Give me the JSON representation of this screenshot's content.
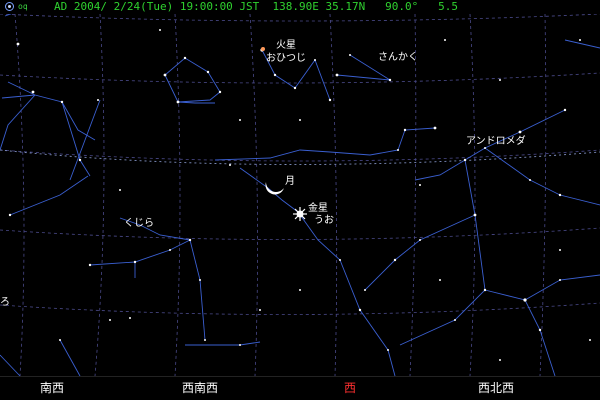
{
  "status": {
    "logo_text": "oq",
    "text": "AD 2004/ 2/24(Tue) 19:00:00 JST  138.90E 35.17N   90.0°   5.5"
  },
  "sky": {
    "colors": {
      "lines": "#3a5fd0",
      "grid": "#4a4a8a",
      "ecliptic": "#8090c0",
      "sun": "#ffffff",
      "mars": "#ff9a5a"
    },
    "labels": {
      "mars": "火星",
      "aries": "おひつじ",
      "triangulum": "さんかく",
      "andromeda": "アンドロメダ",
      "moon": "月",
      "venus": "金星",
      "pisces": "うお",
      "cetus": "くじら",
      "edge": "ろ"
    }
  },
  "compass": [
    {
      "label": "南西",
      "active": false
    },
    {
      "label": "西南西",
      "active": false
    },
    {
      "label": "西",
      "active": true
    },
    {
      "label": "西北西",
      "active": false
    }
  ]
}
